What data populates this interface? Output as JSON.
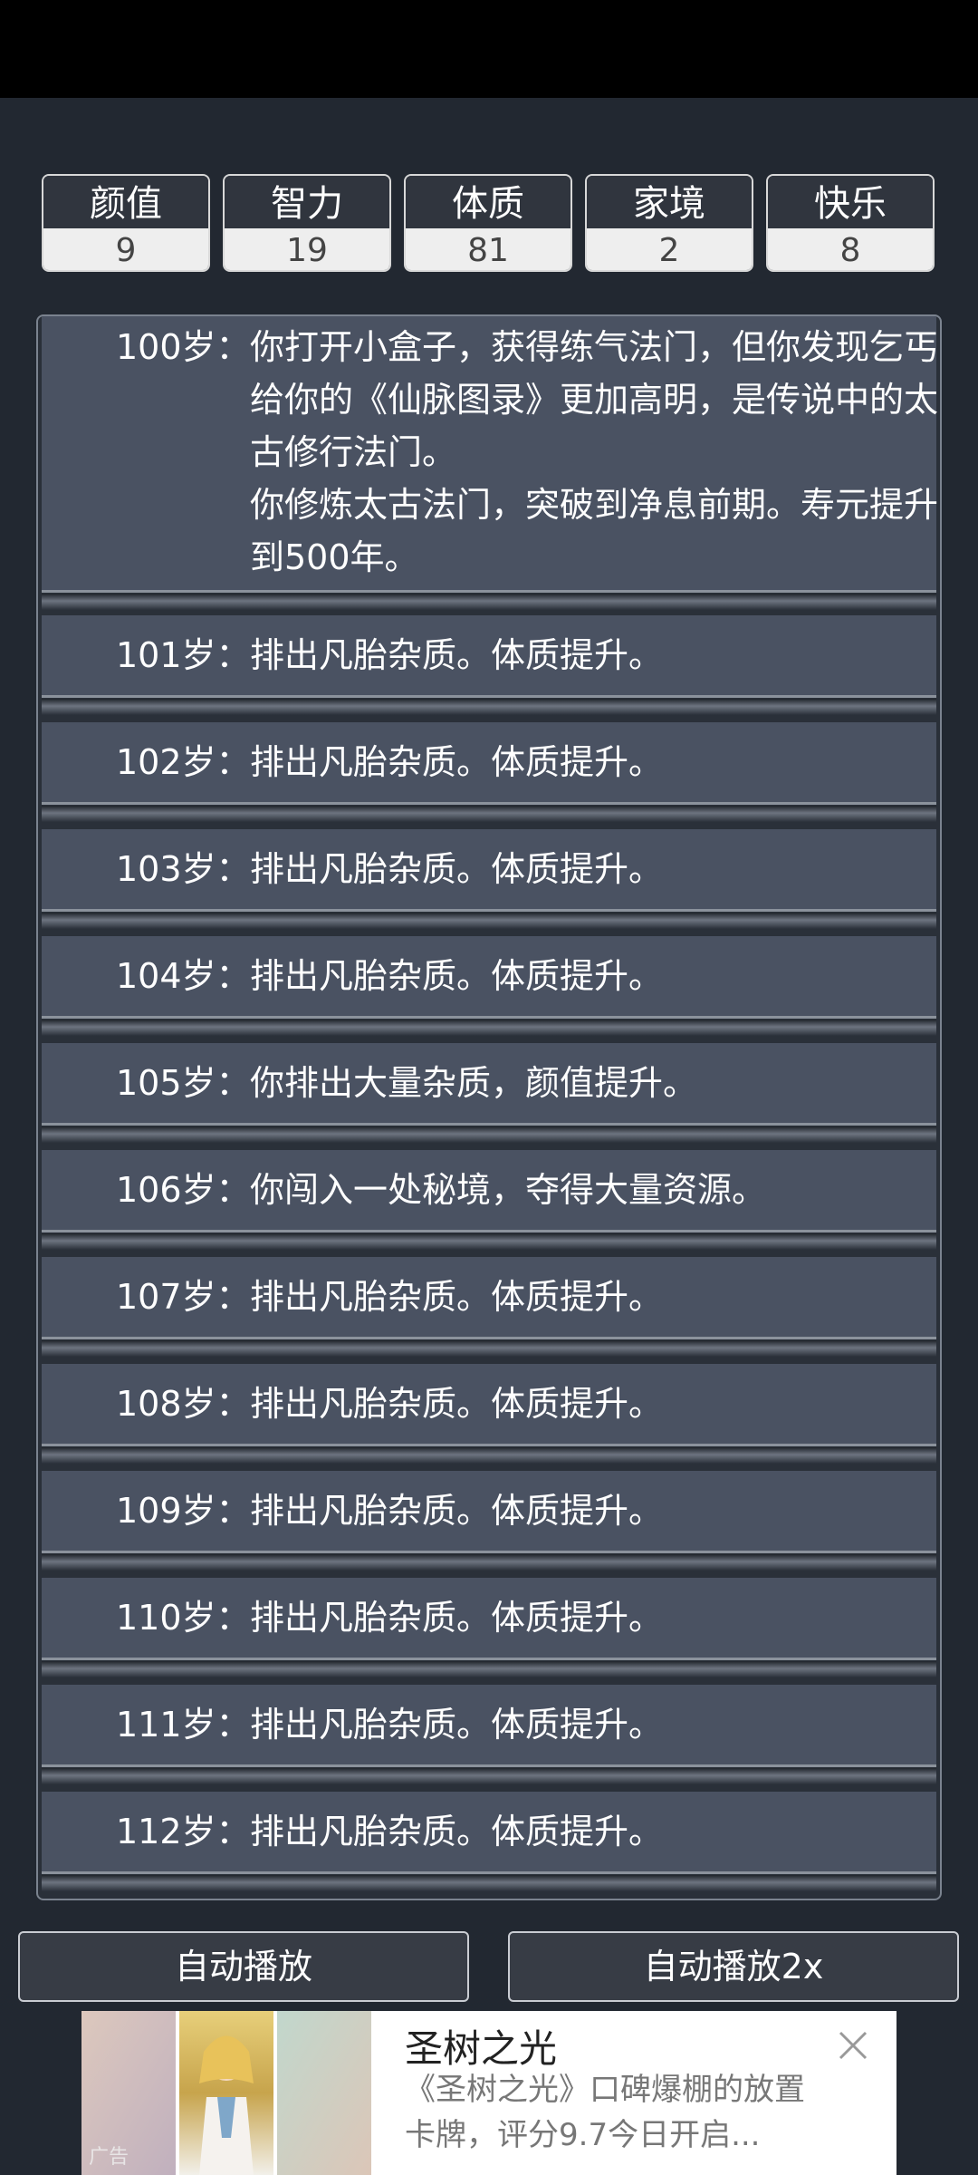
{
  "stats": [
    {
      "label": "颜值",
      "value": "9"
    },
    {
      "label": "智力",
      "value": "19"
    },
    {
      "label": "体质",
      "value": "81"
    },
    {
      "label": "家境",
      "value": "2"
    },
    {
      "label": "快乐",
      "value": "8"
    }
  ],
  "log": {
    "entries": [
      {
        "age": "100岁：",
        "lines": [
          "你打开小盒子，获得练气法门，但你发现乞丐给你的《仙脉图录》更加高明，是传说中的太古修行法门。",
          "你修炼太古法门，突破到净息前期。寿元提升到500年。"
        ]
      },
      {
        "age": "101岁：",
        "lines": [
          "排出凡胎杂质。体质提升。"
        ]
      },
      {
        "age": "102岁：",
        "lines": [
          "排出凡胎杂质。体质提升。"
        ]
      },
      {
        "age": "103岁：",
        "lines": [
          "排出凡胎杂质。体质提升。"
        ]
      },
      {
        "age": "104岁：",
        "lines": [
          "排出凡胎杂质。体质提升。"
        ]
      },
      {
        "age": "105岁：",
        "lines": [
          "你排出大量杂质，颜值提升。"
        ]
      },
      {
        "age": "106岁：",
        "lines": [
          "你闯入一处秘境，夺得大量资源。"
        ]
      },
      {
        "age": "107岁：",
        "lines": [
          "排出凡胎杂质。体质提升。"
        ]
      },
      {
        "age": "108岁：",
        "lines": [
          "排出凡胎杂质。体质提升。"
        ]
      },
      {
        "age": "109岁：",
        "lines": [
          "排出凡胎杂质。体质提升。"
        ]
      },
      {
        "age": "110岁：",
        "lines": [
          "排出凡胎杂质。体质提升。"
        ]
      },
      {
        "age": "111岁：",
        "lines": [
          "排出凡胎杂质。体质提升。"
        ]
      },
      {
        "age": "112岁：",
        "lines": [
          "排出凡胎杂质。体质提升。"
        ]
      }
    ]
  },
  "buttons": {
    "auto_play": "自动播放",
    "auto_play_2x": "自动播放2x"
  },
  "ad": {
    "title": "圣树之光",
    "description": "《圣树之光》口碑爆棚的放置卡牌，评分9.7今日开启...",
    "tag": "广告",
    "close_icon": "close-icon"
  }
}
